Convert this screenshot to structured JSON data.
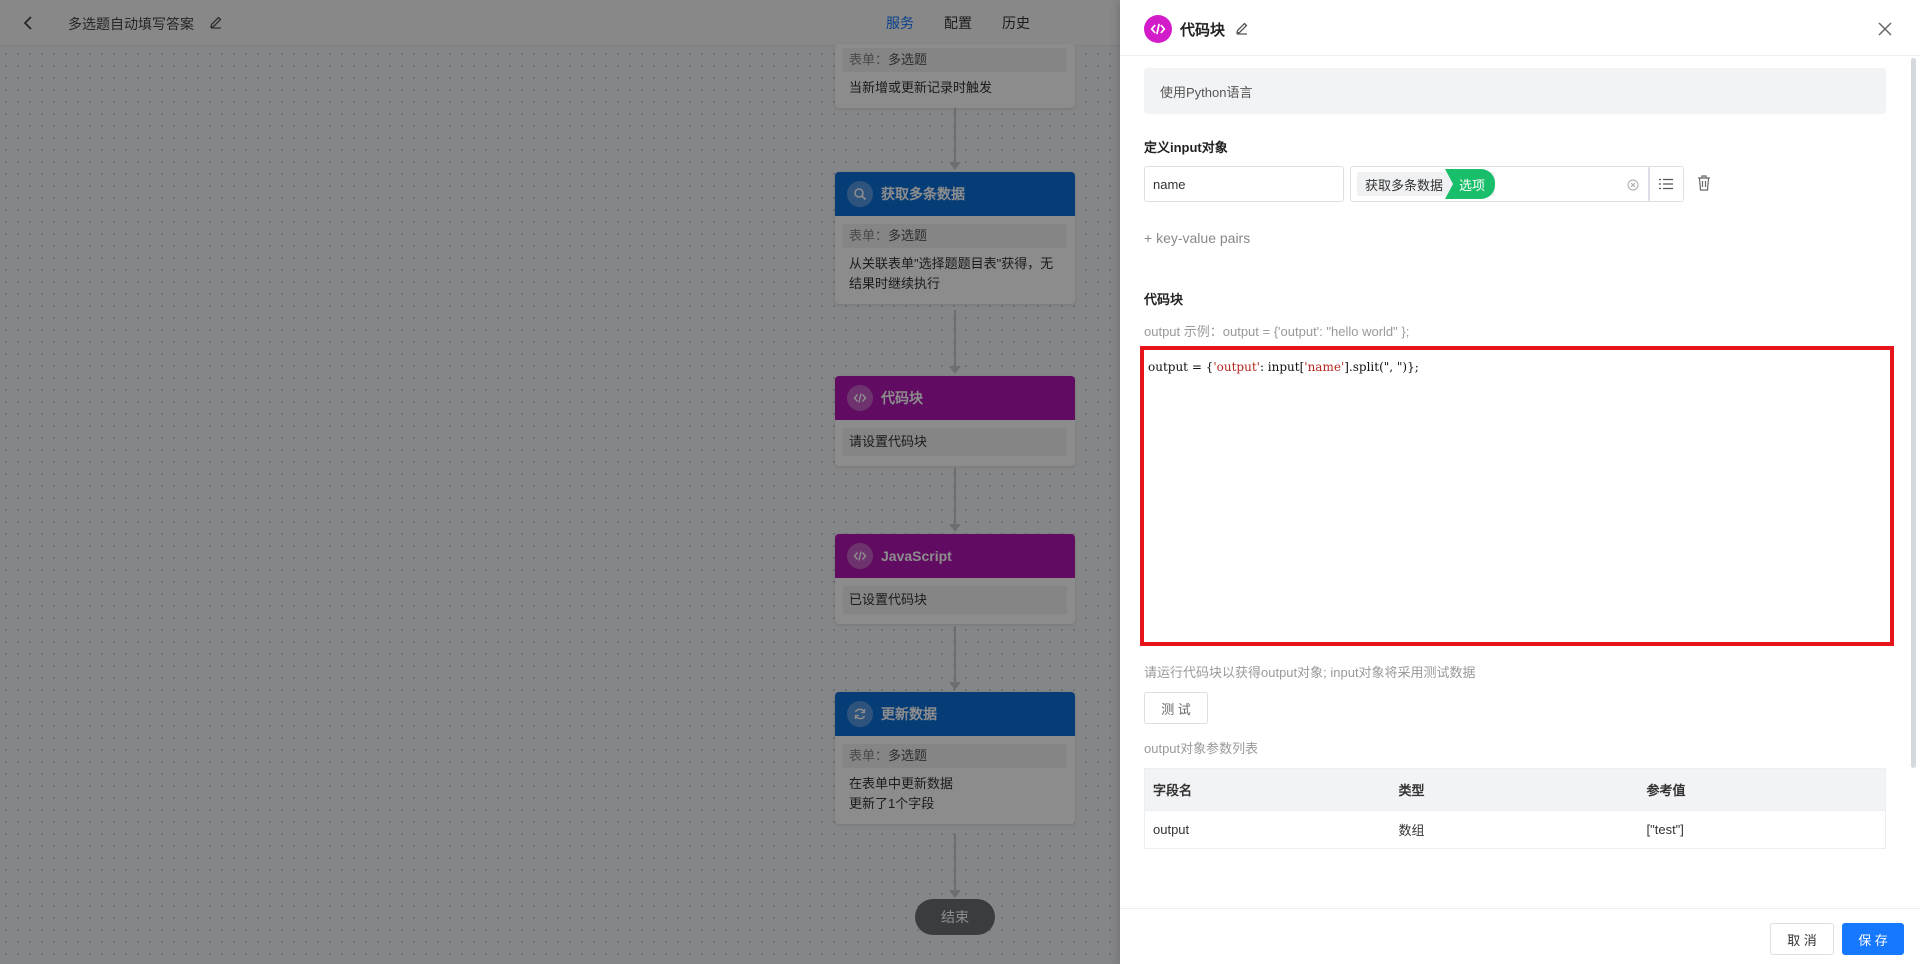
{
  "colors": {
    "accent": "#1677ff",
    "node_blue": "#0b6fd9",
    "node_purple": "#b117b3",
    "code_highlight": "#e8141b",
    "tag_green": "#19be6b"
  },
  "header": {
    "title": "多选题自动填写答案",
    "tabs": [
      {
        "label": "服务",
        "active": true
      },
      {
        "label": "配置",
        "active": false
      },
      {
        "label": "历史",
        "active": false
      }
    ]
  },
  "flow": {
    "nodes": [
      {
        "id": "trigger",
        "title": "",
        "form_label": "表单：",
        "form_value": "多选题",
        "lines": [
          "当新增或更新记录时触发"
        ]
      },
      {
        "id": "fetch",
        "title": "获取多条数据",
        "icon": "search-data-icon",
        "form_label": "表单：",
        "form_value": "多选题",
        "lines": [
          "从关联表单\"选择题题目表\"获得，无",
          "结果时继续执行"
        ]
      },
      {
        "id": "code",
        "title": "代码块",
        "icon": "code-icon",
        "lines": [
          "请设置代码块"
        ]
      },
      {
        "id": "js",
        "title": "JavaScript",
        "icon": "code-icon",
        "lines": [
          "已设置代码块"
        ]
      },
      {
        "id": "update",
        "title": "更新数据",
        "icon": "refresh-icon",
        "form_label": "表单：",
        "form_value": "多选题",
        "lines": [
          "在表单中更新数据",
          "更新了1个字段"
        ]
      }
    ],
    "end_label": "结束"
  },
  "drawer": {
    "title": "代码块",
    "language": "使用Python语言",
    "input_section": "定义input对象",
    "input_key": "name",
    "input_value_tag": "获取多条数据",
    "input_value_sub": "选项",
    "add_pair": "+ key-value pairs",
    "code_section": "代码块",
    "output_example": "output 示例：output = {'output': \"hello world\" };",
    "code": {
      "prefix": "output = {",
      "str1": "'output'",
      "mid": ": input[",
      "str2": "'name'",
      "suffix": "].split(\", \")};"
    },
    "run_hint": "请运行代码块以获得output对象; input对象将采用测试数据",
    "test_button": "测 试",
    "output_list_title": "output对象参数列表",
    "table": {
      "headers": [
        "字段名",
        "类型",
        "参考值"
      ],
      "rows": [
        [
          "output",
          "数组",
          "[\"test\"]"
        ]
      ]
    },
    "cancel_button": "取 消",
    "save_button": "保 存"
  }
}
